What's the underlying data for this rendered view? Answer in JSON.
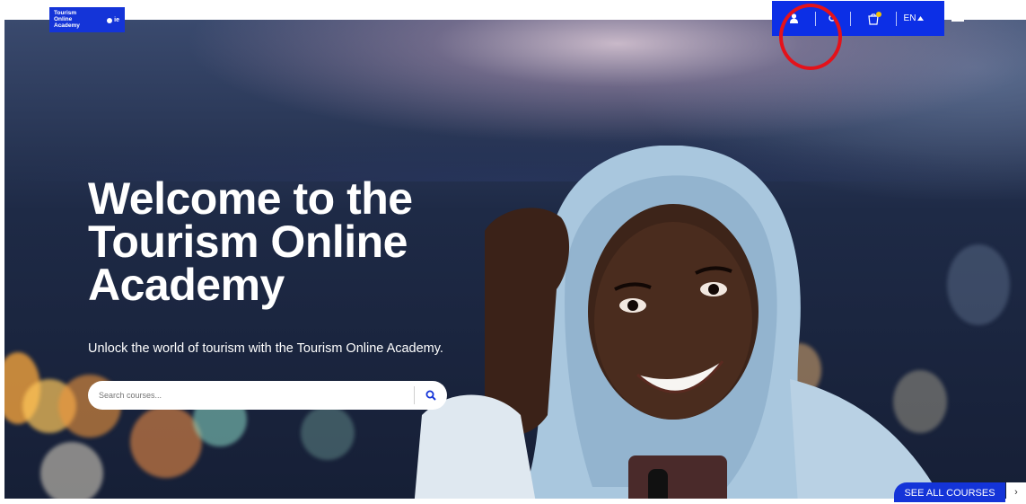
{
  "logo": {
    "lines": [
      "Tourism",
      "Online",
      "Academy"
    ]
  },
  "header": {
    "language": "EN",
    "icons": [
      "user-icon",
      "search-icon",
      "cart-icon",
      "caret-up-icon",
      "menu-icon"
    ]
  },
  "hero": {
    "title": "Welcome to the Tourism Online Academy",
    "subtitle": "Unlock the world of tourism with the Tourism Online Academy."
  },
  "search": {
    "placeholder": "Search courses..."
  },
  "cta": {
    "see_all": "SEE ALL COURSES"
  },
  "colors": {
    "accent": "#0c2fe6",
    "highlight": "#e4121a",
    "hero_dark": "#1e2a46"
  }
}
